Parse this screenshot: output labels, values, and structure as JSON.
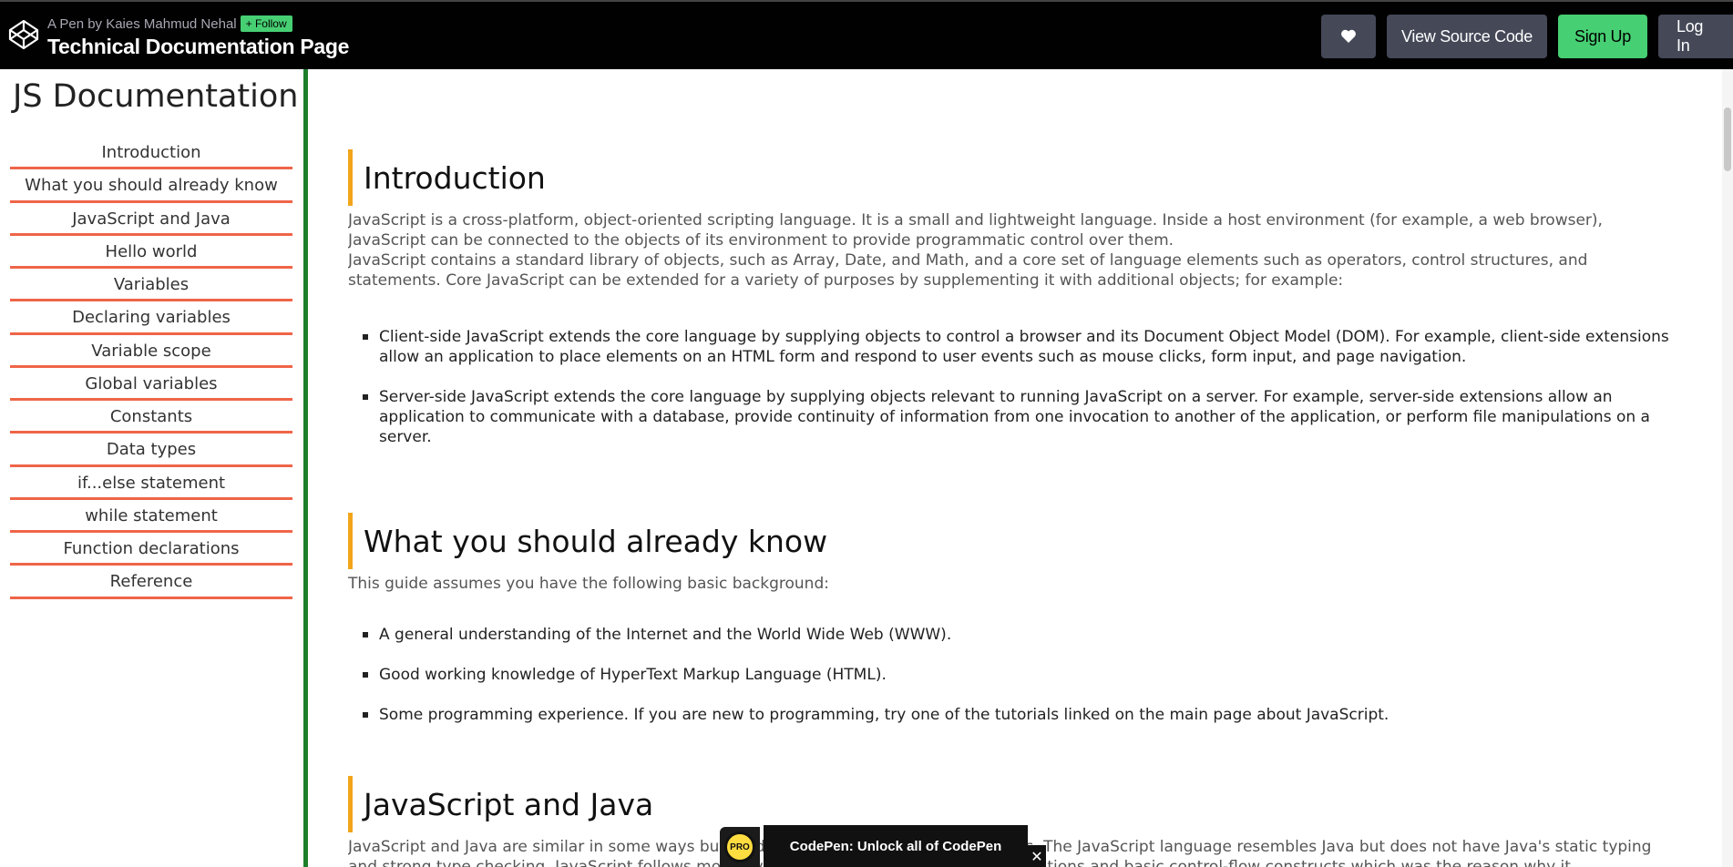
{
  "header": {
    "byline": "A Pen by Kaies Mahmud Nehal",
    "follow_label": "Follow",
    "title": "Technical Documentation Page",
    "view_source_label": "View Source Code",
    "signup_label": "Sign Up",
    "login_label": "Log In",
    "colors": {
      "background": "#010101",
      "signup": "#47cf73",
      "button": "#444857"
    }
  },
  "sidebar": {
    "title": "JS Documentation",
    "items": [
      {
        "label": "Introduction"
      },
      {
        "label": "What you should already know"
      },
      {
        "label": "JavaScript and Java"
      },
      {
        "label": "Hello world"
      },
      {
        "label": "Variables"
      },
      {
        "label": "Declaring variables"
      },
      {
        "label": "Variable scope"
      },
      {
        "label": "Global variables"
      },
      {
        "label": "Constants"
      },
      {
        "label": "Data types"
      },
      {
        "label": "if...else statement"
      },
      {
        "label": "while statement"
      },
      {
        "label": "Function declarations"
      },
      {
        "label": "Reference"
      }
    ],
    "colors": {
      "divider": "#ef6548",
      "border": "#1d7f2a"
    }
  },
  "main": {
    "sections": [
      {
        "title": "Introduction",
        "paragraphs": [
          "JavaScript is a cross-platform, object-oriented scripting language. It is a small and lightweight language. Inside a host environment (for example, a web browser), JavaScript can be connected to the objects of its environment to provide programmatic control over them.",
          "JavaScript contains a standard library of objects, such as Array, Date, and Math, and a core set of language elements such as operators, control structures, and statements. Core JavaScript can be extended for a variety of purposes by supplementing it with additional objects; for example:"
        ],
        "bullets": [
          "Client-side JavaScript extends the core language by supplying objects to control a browser and its Document Object Model (DOM). For example, client-side extensions allow an application to place elements on an HTML form and respond to user events such as mouse clicks, form input, and page navigation.",
          "Server-side JavaScript extends the core language by supplying objects relevant to running JavaScript on a server. For example, server-side extensions allow an application to communicate with a database, provide continuity of information from one invocation to another of the application, or perform file manipulations on a server."
        ]
      },
      {
        "title": "What you should already know",
        "paragraphs": [
          "This guide assumes you have the following basic background:"
        ],
        "bullets": [
          "A general understanding of the Internet and the World Wide Web (WWW).",
          "Good working knowledge of HyperText Markup Language (HTML).",
          "Some programming experience. If you are new to programming, try one of the tutorials linked on the main page about JavaScript."
        ]
      },
      {
        "title": "JavaScript and Java",
        "paragraphs": [
          "JavaScript and Java are similar in some ways but fundamentally different in some others. The JavaScript language resembles Java but does not have Java's static typing and strong type checking. JavaScript follows most Java expression syntax, naming conventions and basic control-flow constructs which was the reason why it"
        ],
        "bullets": []
      }
    ],
    "colors": {
      "section_accent": "#f2a51a"
    }
  },
  "pro_popup": {
    "badge_label": "PRO",
    "message": "CodePen: Unlock all of CodePen",
    "close_glyph": "✕"
  }
}
